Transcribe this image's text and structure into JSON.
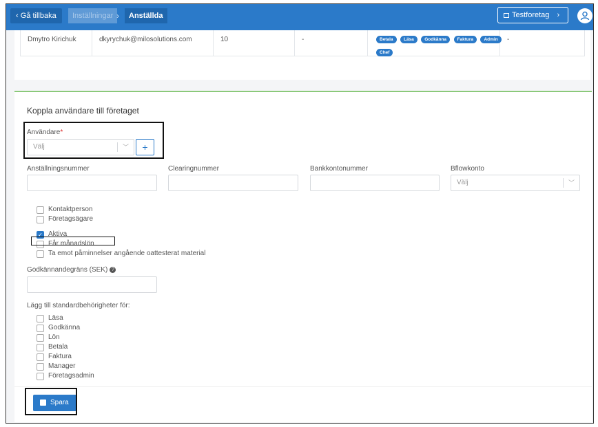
{
  "topbar": {
    "back_label": "‹ Gå tillbaka",
    "breadcrumb": [
      "Inställningar",
      "Anställda"
    ],
    "company_label": "Testforetag",
    "company_chevron": "›",
    "avatar_icon": "user-icon"
  },
  "employee_row": {
    "name": "Dmytro Kirichuk",
    "email": "dkyrychuk@milosolutions.com",
    "number": "10",
    "dash1": "-",
    "roles": [
      "Betala",
      "Läsa",
      "Godkänna",
      "Faktura",
      "Admin",
      "Chef"
    ],
    "dash2": "-"
  },
  "form": {
    "title": "Koppla användare till företaget",
    "user_label": "Användare",
    "required_mark": "*",
    "user_placeholder": "Välj",
    "add_icon": "+",
    "fields": {
      "anstallningsnummer": "Anställningsnummer",
      "clearingnummer": "Clearingnummer",
      "bankkontonummer": "Bankkontonummer",
      "bflowkonto": "Bflowkonto",
      "bflowkonto_placeholder": "Välj"
    },
    "checkboxes_group1": [
      {
        "label": "Kontaktperson",
        "checked": false
      },
      {
        "label": "Företagsägare",
        "checked": false
      }
    ],
    "checkboxes_group2": [
      {
        "label": "Aktiva",
        "checked": true
      },
      {
        "label": "Får månadslön",
        "checked": false
      },
      {
        "label": "Ta emot påminnelser angående oattesterat material",
        "checked": false
      }
    ],
    "approval_limit_label": "Godkännandegräns (SEK)",
    "approval_hint_icon": "?",
    "permissions_title": "Lägg till standardbehörigheter för:",
    "permissions": [
      "Läsa",
      "Godkänna",
      "Lön",
      "Betala",
      "Faktura",
      "Manager",
      "Företagsadmin"
    ],
    "save_label": "Spara",
    "check_mark": "✓",
    "chevron_down": "﹀"
  }
}
